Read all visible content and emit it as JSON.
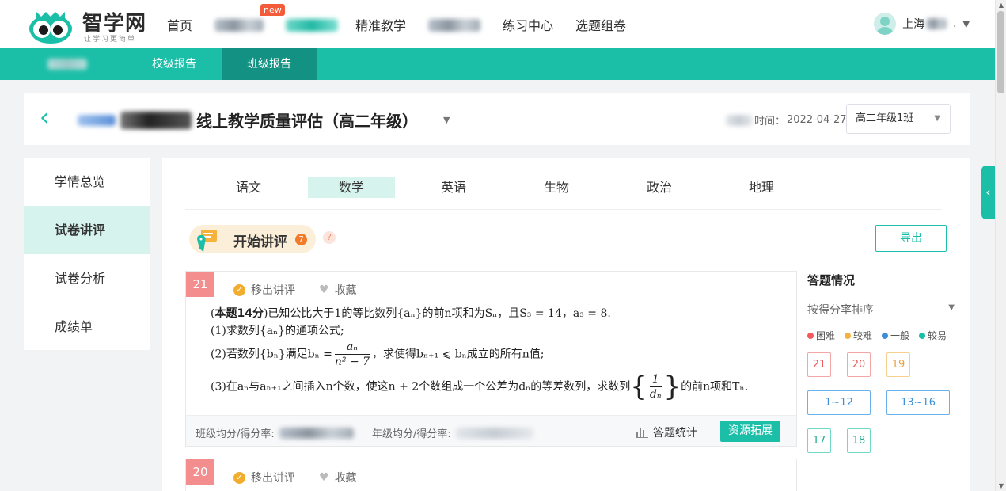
{
  "header": {
    "logo_name": "智学网",
    "logo_slogan": "让学习更简单",
    "nav": [
      {
        "label": "首页"
      },
      {
        "label": ""
      },
      {
        "label": ""
      },
      {
        "label": "精准教学"
      },
      {
        "label": ""
      },
      {
        "label": "练习中心"
      },
      {
        "label": "选题组卷"
      }
    ],
    "new_badge": "new",
    "user_name": "上海",
    "user_suffix": "."
  },
  "subnav": {
    "items": [
      {
        "label": ""
      },
      {
        "label": "校级报告"
      },
      {
        "label": "班级报告"
      }
    ]
  },
  "title_card": {
    "title": "线上教学质量评估（高二年级）",
    "date_label": "时间：",
    "date": "2022-04-27",
    "class_select": "高二年级1班"
  },
  "side_menu": [
    {
      "label": "学情总览"
    },
    {
      "label": "试卷讲评"
    },
    {
      "label": "试卷分析"
    },
    {
      "label": "成绩单"
    }
  ],
  "subjects": [
    {
      "label": "语文"
    },
    {
      "label": "数学"
    },
    {
      "label": "英语"
    },
    {
      "label": "生物"
    },
    {
      "label": "政治"
    },
    {
      "label": "地理"
    }
  ],
  "review": {
    "start_label": "开始讲评",
    "count": "7",
    "help": "?",
    "export_label": "导出"
  },
  "questions": [
    {
      "number": "21",
      "remove_label": "移出讲评",
      "fav_label": "收藏",
      "score_label": "本题14分",
      "stem": "已知公比大于1的等比数列{aₙ}的前n项和为Sₙ，且S₃ = 14，a₃ = 8.",
      "part1": "(1)求数列{aₙ}的通项公式;",
      "part2_a": "(2)若数列{bₙ}满足bₙ =",
      "part2_num": "aₙ",
      "part2_den": "n² − 7",
      "part2_b": "，求使得bₙ₊₁ ⩽ bₙ成立的所有n值;",
      "part3_a": "(3)在aₙ与aₙ₊₁之间插入n个数，使这n + 2个数组成一个公差为dₙ的等差数列，求数列",
      "part3_num": "1",
      "part3_den": "dₙ",
      "part3_b": "的前n项和Tₙ.",
      "class_avg_label": "班级均分/得分率:",
      "grade_avg_label": "年级均分/得分率:",
      "stat_label": "答题统计",
      "resource_label": "资源拓展"
    },
    {
      "number": "20",
      "remove_label": "移出讲评",
      "fav_label": "收藏"
    }
  ],
  "answer_panel": {
    "title": "答题情况",
    "sort_label": "按得分率排序",
    "legend": [
      {
        "label": "困难",
        "color": "#f25b5b"
      },
      {
        "label": "较难",
        "color": "#f5b33d"
      },
      {
        "label": "一般",
        "color": "#3b8fd8"
      },
      {
        "label": "较易",
        "color": "#1bbfa8"
      }
    ],
    "boxes": [
      "21",
      "20",
      "19",
      "1~12",
      "13~16",
      "17",
      "18"
    ]
  },
  "colors": {
    "accent": "#1bbfa8",
    "accent_dark": "#139283",
    "badge_red": "#f48e8e"
  }
}
